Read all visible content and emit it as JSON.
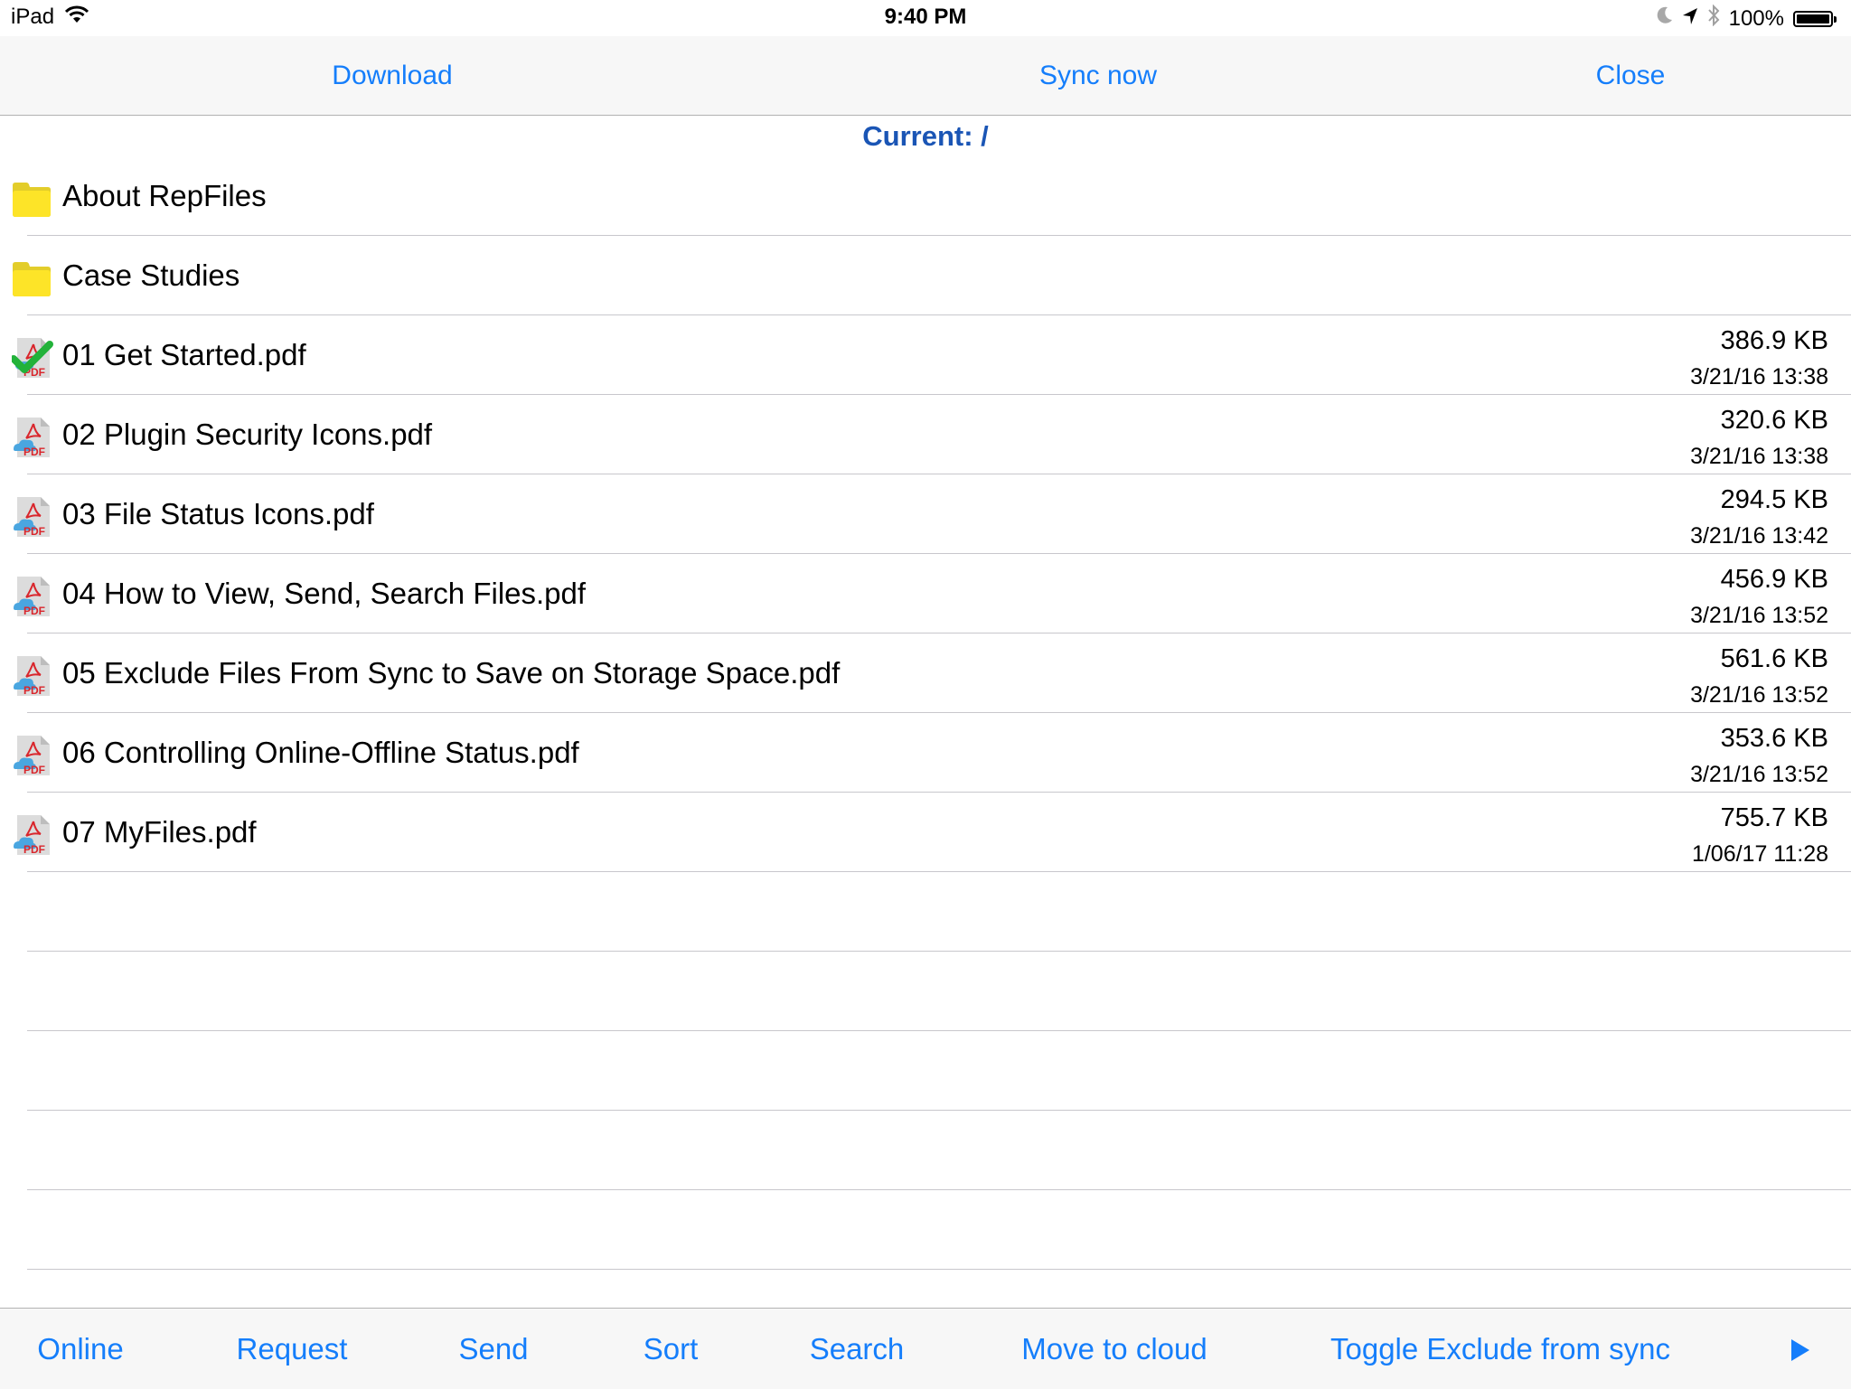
{
  "status_bar": {
    "device": "iPad",
    "time": "9:40 PM",
    "battery": "100%",
    "icons": [
      "wifi-icon",
      "moon-icon",
      "location-arrow-icon",
      "bluetooth-icon",
      "battery-icon"
    ]
  },
  "top_toolbar": {
    "download_label": "Download",
    "sync_label": "Sync now",
    "close_label": "Close"
  },
  "current_path": "Current: /",
  "items": [
    {
      "type": "folder",
      "name": "About RepFiles",
      "icon": "folder-icon"
    },
    {
      "type": "folder",
      "name": "Case Studies",
      "icon": "folder-icon"
    },
    {
      "type": "file",
      "name": "01 Get Started.pdf",
      "size": "386.9 KB",
      "date": "3/21/16 13:38",
      "icon": "pdf-downloaded-icon",
      "status": "downloaded"
    },
    {
      "type": "file",
      "name": "02 Plugin Security Icons.pdf",
      "size": "320.6 KB",
      "date": "3/21/16 13:38",
      "icon": "pdf-cloud-icon",
      "status": "cloud"
    },
    {
      "type": "file",
      "name": "03 File Status Icons.pdf",
      "size": "294.5 KB",
      "date": "3/21/16 13:42",
      "icon": "pdf-cloud-icon",
      "status": "cloud"
    },
    {
      "type": "file",
      "name": "04 How to View, Send, Search Files.pdf",
      "size": "456.9 KB",
      "date": "3/21/16 13:52",
      "icon": "pdf-cloud-icon",
      "status": "cloud"
    },
    {
      "type": "file",
      "name": "05 Exclude Files From Sync to Save on Storage Space.pdf",
      "size": "561.6 KB",
      "date": "3/21/16 13:52",
      "icon": "pdf-cloud-icon",
      "status": "cloud"
    },
    {
      "type": "file",
      "name": "06 Controlling Online-Offline Status.pdf",
      "size": "353.6 KB",
      "date": "3/21/16 13:52",
      "icon": "pdf-cloud-icon",
      "status": "cloud"
    },
    {
      "type": "file",
      "name": "07 MyFiles.pdf",
      "size": "755.7 KB",
      "date": "1/06/17 11:28",
      "icon": "pdf-cloud-icon",
      "status": "cloud"
    }
  ],
  "bottom_toolbar": {
    "online_label": "Online",
    "request_label": "Request",
    "send_label": "Send",
    "sort_label": "Sort",
    "search_label": "Search",
    "move_to_cloud_label": "Move to cloud",
    "toggle_exclude_label": "Toggle Exclude from sync",
    "more_icon": "play-arrow-icon"
  },
  "colors": {
    "accent": "#157efb",
    "current_path": "#1a55b5",
    "folder": "#fde428",
    "toolbar_bg": "#f7f7f7",
    "separator": "#c8c7cc",
    "check": "#22b23a",
    "pdf_red": "#d9262c",
    "cloud": "#4aa6e0"
  }
}
